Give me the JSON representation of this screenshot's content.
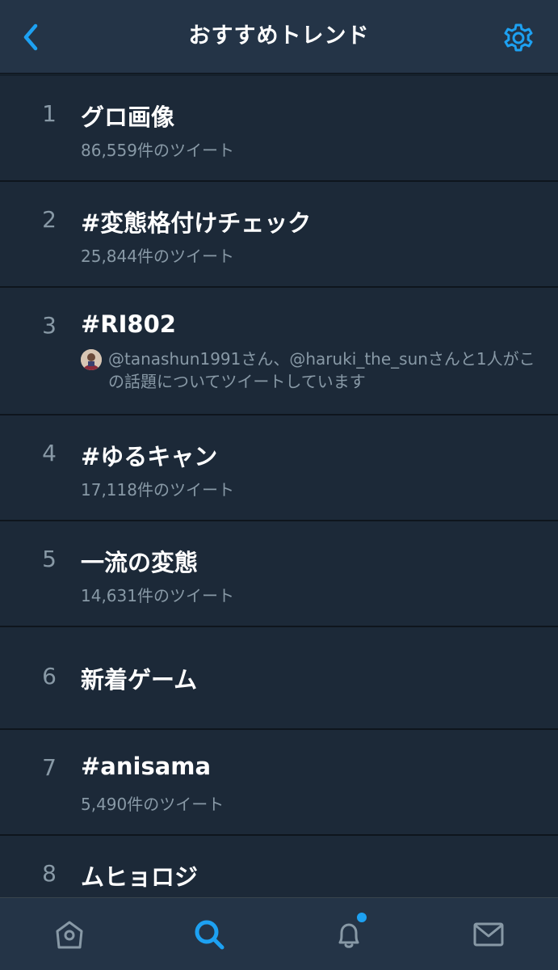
{
  "header": {
    "title": "おすすめトレンド",
    "back_icon": "chevron-left-icon",
    "settings_icon": "gear-icon"
  },
  "trends": [
    {
      "rank": "1",
      "name": "グロ画像",
      "count": "86,559件のツイート"
    },
    {
      "rank": "2",
      "name": "#変態格付けチェック",
      "count": "25,844件のツイート"
    },
    {
      "rank": "3",
      "name": "#RI802",
      "context": "@tanashun1991さん、@haruki_the_sunさんと1人がこの話題についてツイートしています"
    },
    {
      "rank": "4",
      "name": "#ゆるキャン",
      "count": "17,118件のツイート"
    },
    {
      "rank": "5",
      "name": "一流の変態",
      "count": "14,631件のツイート"
    },
    {
      "rank": "6",
      "name": "新着ゲーム"
    },
    {
      "rank": "7",
      "name": "#anisama",
      "count": "5,490件のツイート"
    },
    {
      "rank": "8",
      "name": "ムヒョロジ"
    }
  ],
  "tabbar": {
    "items": [
      {
        "icon": "home-icon",
        "active": false
      },
      {
        "icon": "search-icon",
        "active": true
      },
      {
        "icon": "bell-icon",
        "active": false,
        "has_badge": true
      },
      {
        "icon": "mail-icon",
        "active": false
      }
    ]
  },
  "colors": {
    "accent": "#1da1f2",
    "background": "#15202b",
    "row_background": "#1c2938",
    "header_background": "#243447",
    "secondary_text": "#8899a6"
  }
}
